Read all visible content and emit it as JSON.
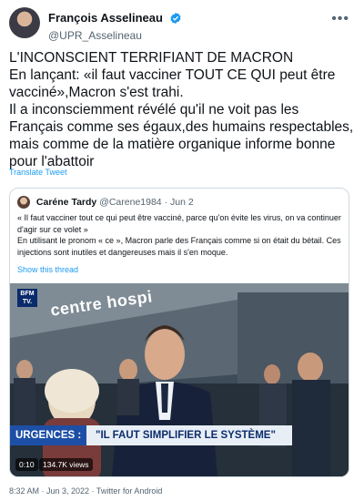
{
  "author": {
    "name": "François Asselineau",
    "handle": "@UPR_Asselineau"
  },
  "tweet": {
    "text": "L'INCONSCIENT TERRIFIANT DE MACRON\nEn lançant: «il faut vacciner TOUT CE QUI peut être vacciné»,Macron s'est trahi.\nIl a inconsciemment révélé qu'il ne voit pas les Français comme ses égaux,des humains respectables, mais comme de la matière organique informe bonne pour l'abattoir",
    "translate_label": "Translate Tweet"
  },
  "quote": {
    "name": "Caréne Tardy",
    "handle": "@Carene1984",
    "date": "Jun 2",
    "text": "« Il faut vacciner tout ce qui peut être vacciné, parce qu'on évite les virus, on va continuer d'agir sur ce volet »\nEn utilisant le pronom « ce », Macron parle des Français comme si on était du bétail. Ces injections sont inutiles et dangereuses mais il s'en moque.",
    "show_thread": "Show this thread"
  },
  "video": {
    "logo": "BFM TV.",
    "wall_text": "centre hospi",
    "banner_tag": "URGENCES :",
    "banner_text": "\"IL FAUT SIMPLIFIER LE SYSTÈME\"",
    "timecode": "0:10",
    "views": "134.7K views"
  },
  "footer": {
    "timestamp": "8:32 AM · Jun 3, 2022 · Twitter for Android"
  },
  "colors": {
    "link": "#1d9bf0",
    "muted": "#536471",
    "banner_blue": "#1d4fa6"
  },
  "icons": [
    "verified-badge-icon",
    "more-options-icon"
  ]
}
